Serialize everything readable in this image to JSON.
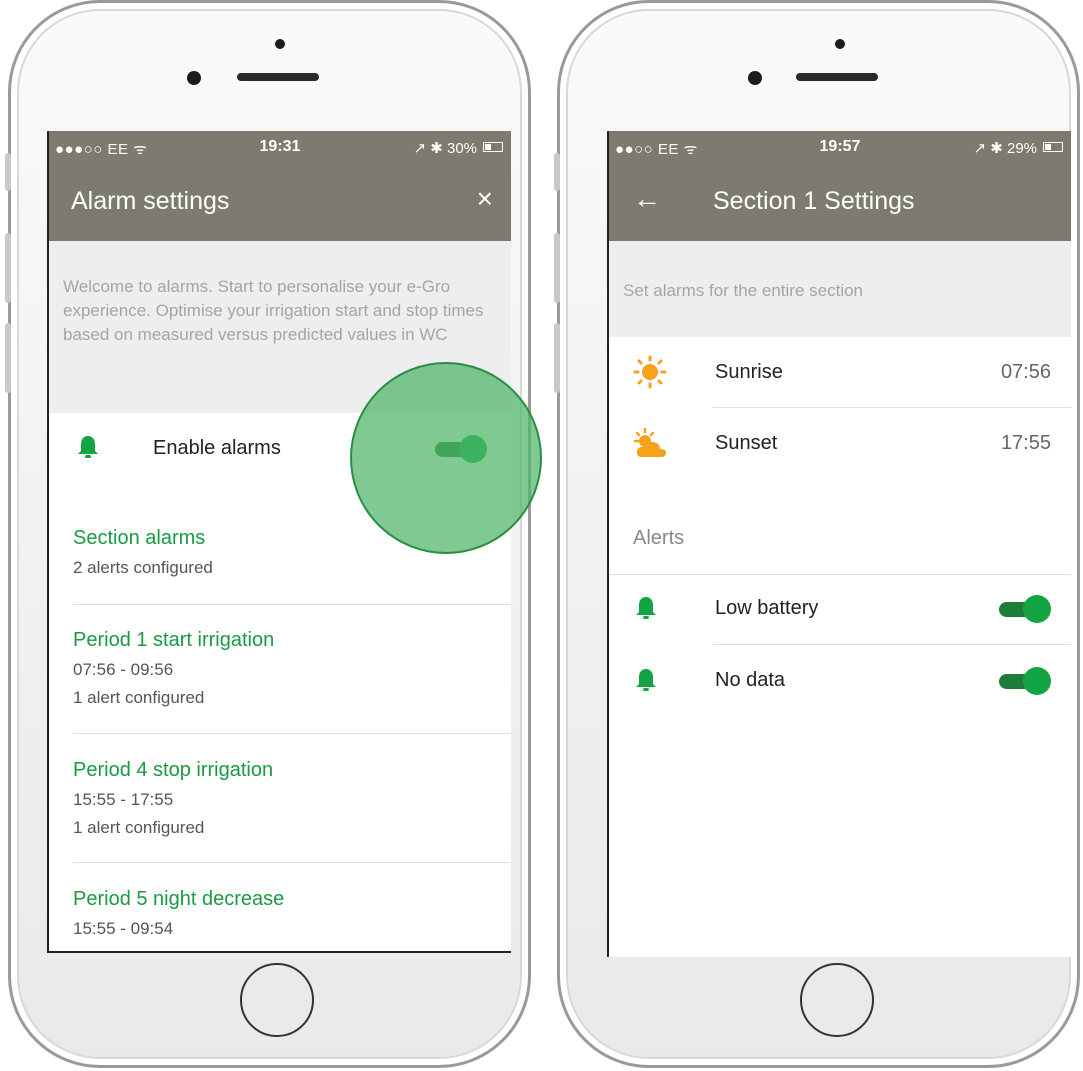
{
  "left_phone": {
    "status": {
      "carrier": "●●●○○ EE ᯤ",
      "time": "19:31",
      "right": "↗ ✱ 30%",
      "battery_level": 0.3
    },
    "appbar": {
      "title": "Alarm settings",
      "close_icon": "×"
    },
    "intro": "Welcome to alarms. Start to personalise your e-Gro experience. Optimise your irrigation start and stop times based on measured versus predicted values in WC",
    "enable_label": "Enable alarms",
    "enable_on": true,
    "items": [
      {
        "title": "Section alarms",
        "lines": [
          "2 alerts configured"
        ]
      },
      {
        "title": "Period 1 start irrigation",
        "lines": [
          "07:56 - 09:56",
          "1 alert configured"
        ]
      },
      {
        "title": "Period 4 stop irrigation",
        "lines": [
          "15:55 - 17:55",
          "1 alert configured"
        ]
      },
      {
        "title": "Period 5 night decrease",
        "lines": [
          "15:55 - 09:54"
        ]
      }
    ]
  },
  "right_phone": {
    "status": {
      "carrier": "●●○○ EE ᯤ",
      "time": "19:57",
      "right": "↗ ✱ 29%",
      "battery_level": 0.29
    },
    "appbar": {
      "title": "Section 1 Settings",
      "back_icon": "←"
    },
    "intro": "Set alarms for the entire section",
    "sun": [
      {
        "label": "Sunrise",
        "time": "07:56",
        "icon": "sunrise-icon"
      },
      {
        "label": "Sunset",
        "time": "17:55",
        "icon": "sunset-icon"
      }
    ],
    "alerts_header": "Alerts",
    "alerts": [
      {
        "label": "Low battery",
        "on": true
      },
      {
        "label": "No data",
        "on": true
      }
    ]
  },
  "colors": {
    "appbar": "#7d7a6f",
    "accent_green": "#1a9a44",
    "sun_orange": "#f7a21b"
  }
}
